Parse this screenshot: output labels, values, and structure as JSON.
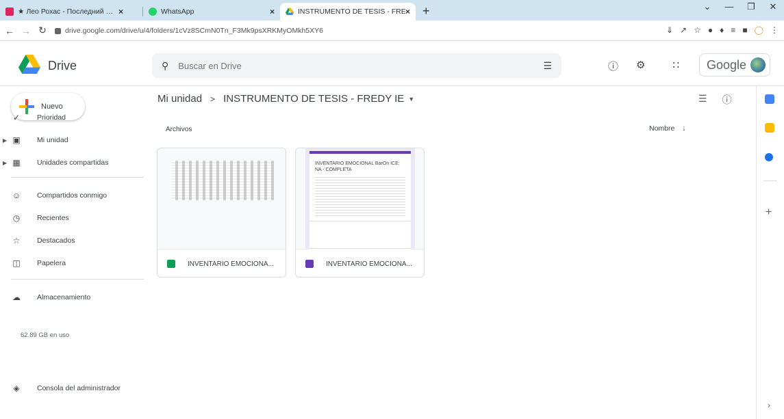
{
  "browser": {
    "tabs": [
      {
        "label": "★ Лео Рохас - Последний …",
        "close": "×"
      },
      {
        "label": "WhatsApp",
        "close": "×"
      },
      {
        "label": "INSTRUMENTO DE TESIS - FRED…",
        "close": "×"
      }
    ],
    "new_tab": "+",
    "url": "drive.google.com/drive/u/4/folders/1cVz8SCmN0Tn_F3Mk9psXRKMyOMkh5XY6"
  },
  "header": {
    "app_name": "Drive",
    "search_placeholder": "Buscar en Drive",
    "google_label": "Google"
  },
  "sidebar": {
    "new_label": "Nuevo",
    "items": [
      {
        "label": "Prioridad",
        "icon": "check-circle-icon"
      },
      {
        "label": "Mi unidad",
        "icon": "my-drive-icon"
      },
      {
        "label": "Unidades compartidas",
        "icon": "shared-drives-icon"
      },
      {
        "label": "Compartidos conmigo",
        "icon": "people-icon"
      },
      {
        "label": "Recientes",
        "icon": "clock-icon"
      },
      {
        "label": "Destacados",
        "icon": "star-icon"
      },
      {
        "label": "Papelera",
        "icon": "trash-icon"
      },
      {
        "label": "Almacenamiento",
        "icon": "cloud-icon"
      }
    ],
    "storage_used": "62.89 GB en uso",
    "admin_console": "Consola del administrador"
  },
  "main": {
    "breadcrumb_root": "Mi unidad",
    "breadcrumb_separator": ">",
    "breadcrumb_current": "INSTRUMENTO DE TESIS - FREDY IE",
    "section_label": "Archivos",
    "sort_label": "Nombre",
    "files": [
      {
        "name": "INVENTARIO EMOCIONA...",
        "type": "sheets"
      },
      {
        "name": "INVENTARIO EMOCIONA...",
        "type": "forms",
        "preview_title": "INVENTARIO EMOCIONAL BarOn ICE: NA - COMPLETA"
      }
    ]
  },
  "colors": {
    "sheets": "#0f9d58",
    "forms": "#673ab7"
  }
}
